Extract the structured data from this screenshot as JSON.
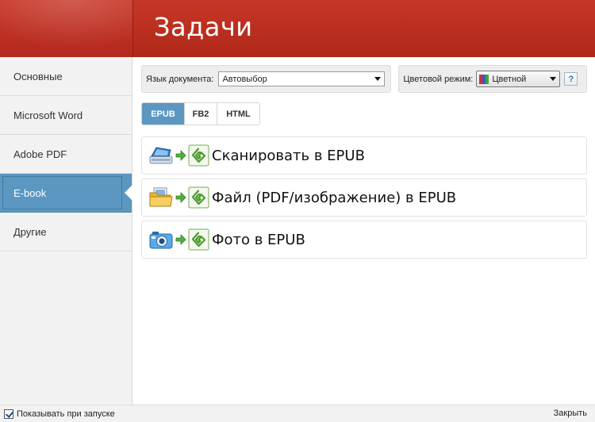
{
  "header": {
    "title": "Задачи"
  },
  "sidebar": {
    "items": [
      {
        "label": "Основные",
        "active": false
      },
      {
        "label": "Microsoft Word",
        "active": false
      },
      {
        "label": "Adobe PDF",
        "active": false
      },
      {
        "label": "E-book",
        "active": true
      },
      {
        "label": "Другие",
        "active": false
      }
    ]
  },
  "toolbar": {
    "language_label": "Язык документа:",
    "language_value": "Автовыбор",
    "color_label": "Цветовой режим:",
    "color_value": "Цветной",
    "help_label": "?"
  },
  "tabs": [
    {
      "label": "EPUB",
      "active": true
    },
    {
      "label": "FB2",
      "active": false
    },
    {
      "label": "HTML",
      "active": false
    }
  ],
  "tasks": [
    {
      "label": "Сканировать в EPUB",
      "source_icon": "scanner-icon"
    },
    {
      "label": "Файл (PDF/изображение) в EPUB",
      "source_icon": "folder-icon"
    },
    {
      "label": "Фото в EPUB",
      "source_icon": "camera-icon"
    }
  ],
  "footer": {
    "show_on_startup_label": "Показывать при запуске",
    "show_on_startup_checked": true,
    "close_label": "Закрыть"
  },
  "colors": {
    "header_red": "#c73627",
    "accent_blue": "#5b97c1",
    "arrow_green": "#4fb23a"
  }
}
